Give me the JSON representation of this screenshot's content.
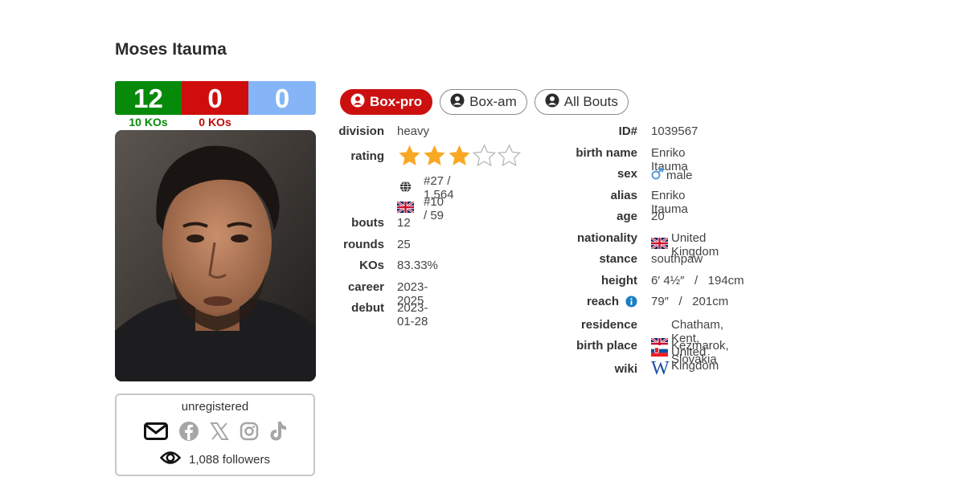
{
  "boxer": {
    "name": "Moses Itauma"
  },
  "record": {
    "wins": "12",
    "losses": "0",
    "draws": "0",
    "wins_ko": "10 KOs",
    "losses_ko": "0 KOs",
    "colors": {
      "win": "#078a09",
      "loss": "#cf0d0d",
      "draw": "#85b5f6"
    }
  },
  "social": {
    "status": "unregistered",
    "icons": [
      "envelope-icon",
      "facebook-icon",
      "x-icon",
      "instagram-icon",
      "tiktok-icon"
    ],
    "followers": "1,088 followers"
  },
  "tabs": [
    {
      "label": "Box-pro",
      "active": true
    },
    {
      "label": "Box-am",
      "active": false
    },
    {
      "label": "All Bouts",
      "active": false
    }
  ],
  "left_info": {
    "division": {
      "label": "division",
      "value": "heavy"
    },
    "rating": {
      "label": "rating",
      "stars_filled": 3,
      "stars_total": 5,
      "world_rank": "#27 / 1,564",
      "country_rank": "#10 / 59"
    },
    "bouts": {
      "label": "bouts",
      "value": "12"
    },
    "rounds": {
      "label": "rounds",
      "value": "25"
    },
    "kos": {
      "label": "KOs",
      "value": "83.33%"
    },
    "career": {
      "label": "career",
      "value": "2023-2025"
    },
    "debut": {
      "label": "debut",
      "value": "2023-01-28"
    }
  },
  "right_info": {
    "id": {
      "label": "ID#",
      "value": "1039567"
    },
    "birth_name": {
      "label": "birth name",
      "value": "Enriko Itauma"
    },
    "sex": {
      "label": "sex",
      "value": "male"
    },
    "alias": {
      "label": "alias",
      "value": "Enriko Itauma"
    },
    "age": {
      "label": "age",
      "value": "20"
    },
    "nationality": {
      "label": "nationality",
      "value": "United Kingdom"
    },
    "stance": {
      "label": "stance",
      "value": "southpaw"
    },
    "height": {
      "label": "height",
      "value": "6′ 4½″   /   194cm"
    },
    "reach": {
      "label": "reach",
      "value": "79″   /   201cm"
    },
    "residence": {
      "label": "residence",
      "value": "Chatham, Kent, United Kingdom"
    },
    "birth_place": {
      "label": "birth place",
      "value": "Kezmarok, Slovakia"
    },
    "wiki": {
      "label": "wiki",
      "value": "W"
    }
  },
  "colors": {
    "star": "#f9a825",
    "tab_active": "#cc1010",
    "info_icon": "#1a7fc1",
    "male_icon": "#5b9bd5"
  }
}
